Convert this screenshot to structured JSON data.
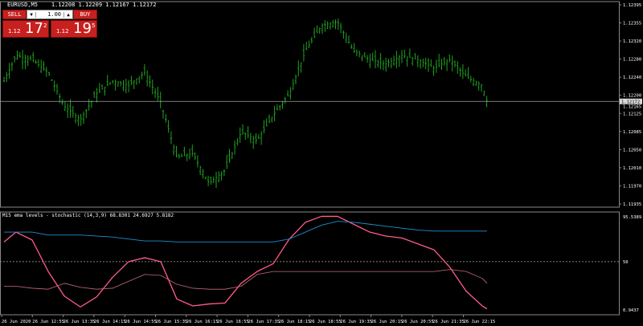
{
  "header": {
    "symbol_title": "EURUSD,M5",
    "ohlc": "1.12208 1.12209 1.12167 1.12172"
  },
  "trade_panel": {
    "sell_label": "SELL",
    "buy_label": "BUY",
    "lot_value": "1.00",
    "bid": {
      "prefix": "1.12",
      "big": "17",
      "sup": "2"
    },
    "ask": {
      "prefix": "1.12",
      "big": "19",
      "sup": "5"
    }
  },
  "price_axis": {
    "ticks": [
      "1.12395",
      "1.12355",
      "1.12320",
      "1.12280",
      "1.12240",
      "1.12200",
      "1.12125",
      "1.12085",
      "1.12050",
      "1.12010",
      "1.11970",
      "1.11935"
    ],
    "current_price_label": "1.12172",
    "secondary_label": "1.12165"
  },
  "indicator": {
    "title": "M15 ema levels - stochastic (14,3,9) 68.8301 24.6927 5.8182",
    "ticks": [
      "95.5389",
      "50",
      "0.9437"
    ]
  },
  "time_axis": {
    "labels": [
      "26 Jun 2020",
      "26 Jun 12:55",
      "26 Jun 13:35",
      "26 Jun 14:15",
      "26 Jun 14:55",
      "26 Jun 15:35",
      "26 Jun 16:15",
      "26 Jun 16:55",
      "26 Jun 17:35",
      "26 Jun 18:15",
      "26 Jun 18:55",
      "26 Jun 19:35",
      "26 Jun 20:15",
      "26 Jun 20:55",
      "26 Jun 21:35",
      "26 Jun 22:15"
    ]
  },
  "colors": {
    "candle": "#1fa11f",
    "price_line": "#a0a0a0",
    "stoch_main": "#ff5c8a",
    "stoch_signal": "#c56b78",
    "ema_level": "#1d8fd1",
    "axis_text": "#ffffff"
  },
  "chart_data": [
    {
      "type": "line",
      "x": [
        5,
        20,
        40,
        60,
        80,
        100,
        120,
        140,
        160,
        180,
        200,
        220,
        240,
        260,
        280,
        300,
        320,
        340,
        360,
        380,
        400,
        420,
        440,
        460,
        480,
        500,
        520,
        540,
        560,
        580,
        600,
        606
      ],
      "series": [
        {
          "values": [
            1.1222,
            1.1228,
            1.1227,
            1.1224,
            1.1216,
            1.1213,
            1.1219,
            1.1222,
            1.1221,
            1.1224,
            1.1217,
            1.1204,
            1.1205,
            1.1198,
            1.1201,
            1.121,
            1.1208,
            1.1214,
            1.1219,
            1.1229,
            1.1235,
            1.1236,
            1.1229,
            1.1227,
            1.1226,
            1.1228,
            1.1227,
            1.1225,
            1.1227,
            1.1223,
            1.1221,
            1.12172
          ]
        }
      ],
      "ylim": [
        1.11935,
        1.12395
      ]
    },
    {
      "type": "line",
      "x": [
        5,
        20,
        40,
        60,
        80,
        100,
        120,
        140,
        160,
        180,
        200,
        220,
        240,
        260,
        280,
        300,
        320,
        340,
        360,
        380,
        400,
        420,
        440,
        460,
        480,
        500,
        520,
        540,
        560,
        580,
        600,
        606
      ],
      "series": [
        {
          "values": [
            70,
            80,
            72,
            40,
            15,
            4,
            14,
            34,
            50,
            54,
            50,
            12,
            5,
            7,
            8,
            28,
            40,
            48,
            73,
            90,
            96,
            96,
            88,
            80,
            76,
            74,
            68,
            62,
            44,
            20,
            5,
            2
          ]
        },
        {
          "values": [
            25,
            25,
            23,
            22,
            28,
            24,
            22,
            23,
            30,
            37,
            36,
            27,
            23,
            22,
            22,
            25,
            37,
            40,
            40,
            40,
            40,
            40,
            40,
            40,
            40,
            40,
            40,
            40,
            42,
            40,
            33,
            28
          ]
        },
        {
          "values": [
            80,
            80,
            80,
            77,
            77,
            77,
            76,
            75,
            73,
            71,
            71,
            70,
            70,
            70,
            70,
            70,
            70,
            70,
            73,
            80,
            87,
            91,
            90,
            88,
            86,
            84,
            82,
            81,
            81,
            81,
            81,
            81
          ]
        }
      ],
      "ylim": [
        0.9437,
        95.5389
      ]
    }
  ]
}
